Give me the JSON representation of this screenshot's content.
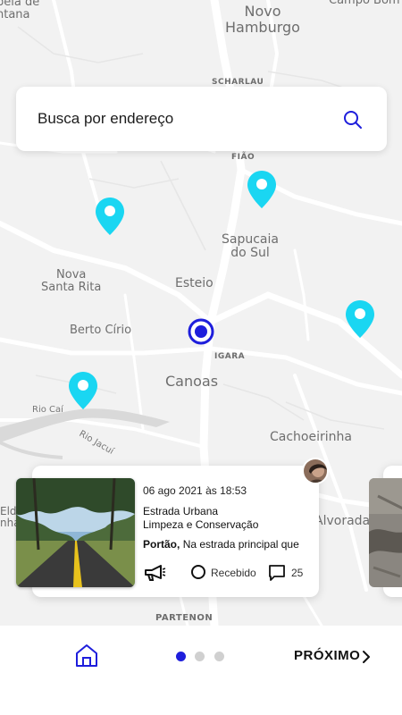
{
  "map": {
    "places": {
      "novo_hamburgo": "Novo\nHamburgo",
      "campo_bom": "Campo Bom",
      "vila_top": "pela de\nntana",
      "scharlau": "SCHARLAU",
      "fiao": "FIÃO",
      "sapucaia": "Sapucaia\ndo Sul",
      "nova_santa_rita": "Nova\nSanta Rita",
      "esteio": "Esteio",
      "berto_cirio": "Berto Círio",
      "igara": "IGARA",
      "canoas": "Canoas",
      "rio_cai": "Rio Caí",
      "rio_jacui": "Rio Jacuí",
      "cachoeirinha": "Cachoeirinha",
      "alvorada": "Alvorada",
      "eldo": "Eld\nnha",
      "partenon": "PARTENON"
    },
    "pin_color": "#1ad6f2",
    "location_color": "#1e1edc"
  },
  "search": {
    "placeholder": "Busca por endereço",
    "icon": "search-icon"
  },
  "card": {
    "date": "06 ago 2021 às 18:53",
    "title_line1": "Estrada Urbana",
    "title_line2": "Limpeza e Conservação",
    "city": "Portão,",
    "description": "Na estrada principal que",
    "status": "Recebido",
    "comments": "25"
  },
  "bottom_nav": {
    "next_label": "PRÓXIMO",
    "pages": 3,
    "active_page": 1,
    "accent": "#1e1edc"
  }
}
